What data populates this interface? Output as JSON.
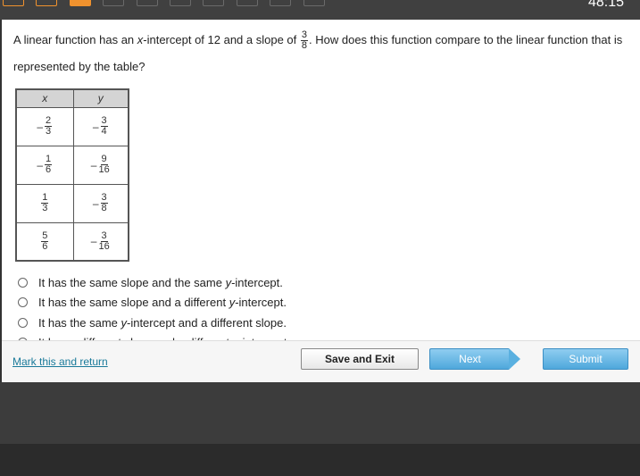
{
  "topbar": {
    "question_count": 10,
    "answered": [
      1,
      2
    ],
    "current": 3,
    "timer": "48:15"
  },
  "question": {
    "part1": "A linear function has an ",
    "var": "x",
    "part2": "-intercept of 12 and a slope of ",
    "slope_num": "3",
    "slope_den": "8",
    "part3": ". How does this function compare to the linear function that is represented by the table?"
  },
  "table": {
    "headers": [
      "x",
      "y"
    ],
    "rows": [
      [
        {
          "neg": true,
          "num": "2",
          "den": "3"
        },
        {
          "neg": true,
          "num": "3",
          "den": "4"
        }
      ],
      [
        {
          "neg": true,
          "num": "1",
          "den": "6"
        },
        {
          "neg": true,
          "num": "9",
          "den": "16"
        }
      ],
      [
        {
          "neg": false,
          "num": "1",
          "den": "3"
        },
        {
          "neg": true,
          "num": "3",
          "den": "8"
        }
      ],
      [
        {
          "neg": false,
          "num": "5",
          "den": "6"
        },
        {
          "neg": true,
          "num": "3",
          "den": "16"
        }
      ]
    ]
  },
  "options": [
    {
      "a": "It has the same slope and the same ",
      "v": "y",
      "b": "-intercept."
    },
    {
      "a": "It has the same slope and a different ",
      "v": "y",
      "b": "-intercept."
    },
    {
      "a": "It has the same ",
      "v": "y",
      "b": "-intercept and a different slope."
    },
    {
      "a": "It has a different slope and a different ",
      "v": "y",
      "b": "-intercept."
    }
  ],
  "footer": {
    "mark_label": "Mark this and return",
    "save_label": "Save and Exit",
    "next_label": "Next",
    "submit_label": "Submit"
  },
  "colors": {
    "accent": "#f0922e",
    "button_blue": "#4fa8dc",
    "link": "#1a7a9a"
  }
}
